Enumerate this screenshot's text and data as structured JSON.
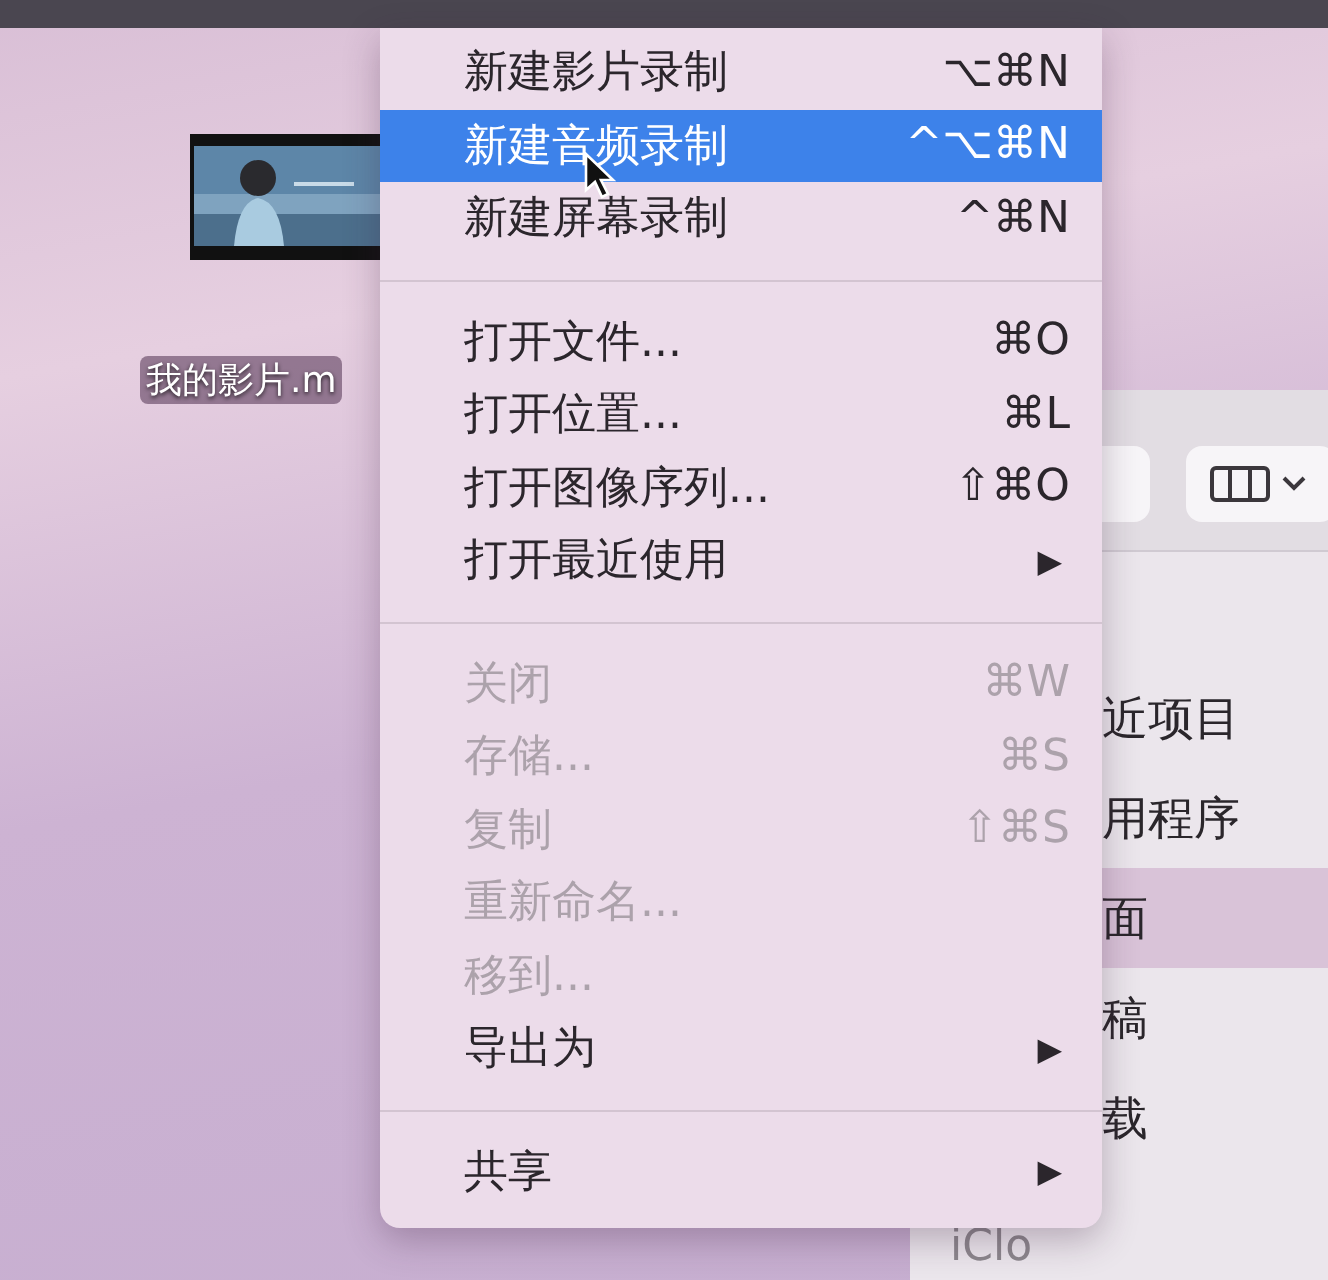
{
  "desktop": {
    "file": {
      "kind": "picture",
      "name": "我的影片.m"
    }
  },
  "finder": {
    "sidebar": {
      "items": [
        {
          "label": "近项目",
          "selected": false
        },
        {
          "label": "用程序",
          "selected": false
        },
        {
          "label": "面",
          "selected": true
        },
        {
          "label": "稿",
          "selected": false
        },
        {
          "label": "载",
          "selected": false
        }
      ]
    },
    "bottom_item": "iClo"
  },
  "menu": {
    "items": [
      {
        "kind": "item",
        "label": "新建影片录制",
        "shortcut": "⌥⌘N",
        "selected": false,
        "disabled": false
      },
      {
        "kind": "item",
        "label": "新建音频录制",
        "shortcut": "^⌥⌘N",
        "selected": true,
        "disabled": false
      },
      {
        "kind": "item",
        "label": "新建屏幕录制",
        "shortcut": "^⌘N",
        "selected": false,
        "disabled": false
      },
      {
        "kind": "separator"
      },
      {
        "kind": "item",
        "label": "打开文件...",
        "shortcut": "⌘O",
        "selected": false,
        "disabled": false
      },
      {
        "kind": "item",
        "label": "打开位置...",
        "shortcut": "⌘L",
        "selected": false,
        "disabled": false
      },
      {
        "kind": "item",
        "label": "打开图像序列...",
        "shortcut": "⇧⌘O",
        "selected": false,
        "disabled": false
      },
      {
        "kind": "submenu",
        "label": "打开最近使用",
        "arrow": "▶",
        "selected": false,
        "disabled": false
      },
      {
        "kind": "separator"
      },
      {
        "kind": "item",
        "label": "关闭",
        "shortcut": "⌘W",
        "selected": false,
        "disabled": true
      },
      {
        "kind": "item",
        "label": "存储...",
        "shortcut": "⌘S",
        "selected": false,
        "disabled": true
      },
      {
        "kind": "item",
        "label": "复制",
        "shortcut": "⇧⌘S",
        "selected": false,
        "disabled": true
      },
      {
        "kind": "item",
        "label": "重新命名...",
        "selected": false,
        "disabled": true
      },
      {
        "kind": "item",
        "label": "移到...",
        "selected": false,
        "disabled": true
      },
      {
        "kind": "submenu",
        "label": "导出为",
        "arrow": "▶",
        "selected": false,
        "disabled": false
      },
      {
        "kind": "separator"
      },
      {
        "kind": "submenu",
        "label": "共享",
        "arrow": "▶",
        "selected": false,
        "disabled": false
      }
    ]
  }
}
